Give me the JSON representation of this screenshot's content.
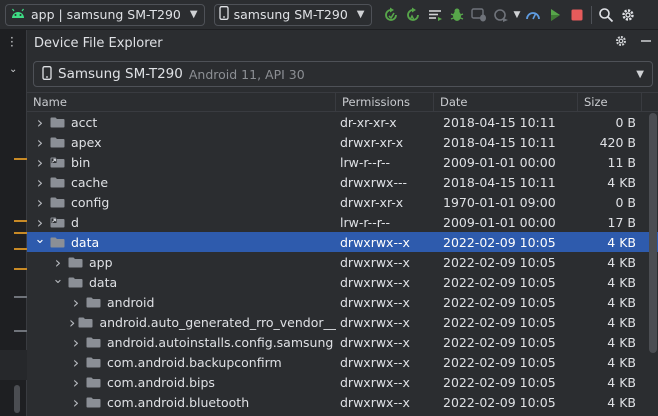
{
  "toolbar": {
    "run_config": "app | samsung SM-T290",
    "device": "samsung SM-T290"
  },
  "panel": {
    "title": "Device File Explorer"
  },
  "device_select": {
    "name": "Samsung SM-T290",
    "meta": "Android 11, API 30"
  },
  "columns": {
    "name": "Name",
    "permissions": "Permissions",
    "date": "Date",
    "size": "Size"
  },
  "rows": [
    {
      "name": "acct",
      "perm": "dr-xr-xr-x",
      "date": "2018-04-15 10:11",
      "size": "0 B",
      "depth": 0,
      "expanded": false,
      "link": false
    },
    {
      "name": "apex",
      "perm": "drwxr-xr-x",
      "date": "2018-04-15 10:11",
      "size": "420 B",
      "depth": 0,
      "expanded": false,
      "link": false
    },
    {
      "name": "bin",
      "perm": "lrw-r--r--",
      "date": "2009-01-01 00:00",
      "size": "11 B",
      "depth": 0,
      "expanded": false,
      "link": true
    },
    {
      "name": "cache",
      "perm": "drwxrwx---",
      "date": "2018-04-15 10:11",
      "size": "4 KB",
      "depth": 0,
      "expanded": false,
      "link": false
    },
    {
      "name": "config",
      "perm": "drwxr-xr-x",
      "date": "1970-01-01 09:00",
      "size": "0 B",
      "depth": 0,
      "expanded": false,
      "link": false
    },
    {
      "name": "d",
      "perm": "lrw-r--r--",
      "date": "2009-01-01 00:00",
      "size": "17 B",
      "depth": 0,
      "expanded": false,
      "link": true
    },
    {
      "name": "data",
      "perm": "drwxrwx--x",
      "date": "2022-02-09 10:05",
      "size": "4 KB",
      "depth": 0,
      "expanded": true,
      "link": false,
      "selected": true
    },
    {
      "name": "app",
      "perm": "drwxrwx--x",
      "date": "2022-02-09 10:05",
      "size": "4 KB",
      "depth": 1,
      "expanded": false,
      "link": false
    },
    {
      "name": "data",
      "perm": "drwxrwx--x",
      "date": "2022-02-09 10:05",
      "size": "4 KB",
      "depth": 1,
      "expanded": true,
      "link": false
    },
    {
      "name": "android",
      "perm": "drwxrwx--x",
      "date": "2022-02-09 10:05",
      "size": "4 KB",
      "depth": 2,
      "expanded": false,
      "link": false
    },
    {
      "name": "android.auto_generated_rro_vendor__",
      "perm": "drwxrwx--x",
      "date": "2022-02-09 10:05",
      "size": "4 KB",
      "depth": 2,
      "expanded": false,
      "link": false
    },
    {
      "name": "android.autoinstalls.config.samsung",
      "perm": "drwxrwx--x",
      "date": "2022-02-09 10:05",
      "size": "4 KB",
      "depth": 2,
      "expanded": false,
      "link": false
    },
    {
      "name": "com.android.backupconfirm",
      "perm": "drwxrwx--x",
      "date": "2022-02-09 10:05",
      "size": "4 KB",
      "depth": 2,
      "expanded": false,
      "link": false
    },
    {
      "name": "com.android.bips",
      "perm": "drwxrwx--x",
      "date": "2022-02-09 10:05",
      "size": "4 KB",
      "depth": 2,
      "expanded": false,
      "link": false
    },
    {
      "name": "com.android.bluetooth",
      "perm": "drwxrwx--x",
      "date": "2022-02-09 10:05",
      "size": "4 KB",
      "depth": 2,
      "expanded": false,
      "link": false
    }
  ],
  "colors": {
    "background": "#2b2d30",
    "selection": "#2e5bad",
    "folder": "#8b8f96",
    "android_green": "#3ddc84",
    "run_green": "#57a64a",
    "stop_red": "#e55b5b"
  }
}
